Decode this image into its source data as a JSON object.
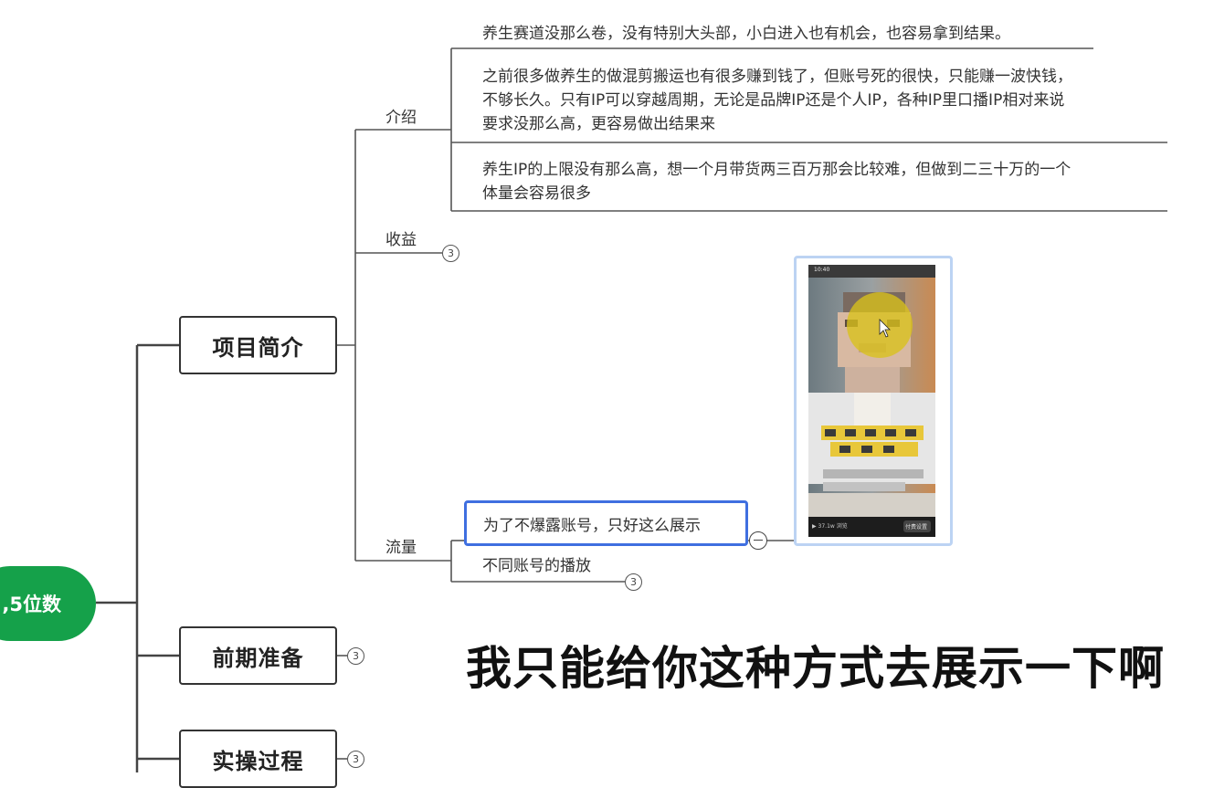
{
  "root": {
    "label": ",5位数"
  },
  "main_nodes": [
    {
      "label": "项目简介"
    },
    {
      "label": "前期准备",
      "collapsed_count": "3"
    },
    {
      "label": "实操过程",
      "collapsed_count": "3"
    }
  ],
  "project_intro": {
    "branches": {
      "intro": {
        "label": "介绍",
        "leaves": [
          "养生赛道没那么卷，没有特别大头部，小白进入也有机会，也容易拿到结果。",
          "之前很多做养生的做混剪搬运也有很多赚到钱了，但账号死的很快，只能赚一波快钱，不够长久。只有IP可以穿越周期，无论是品牌IP还是个人IP，各种IP里口播IP相对来说要求没那么高，更容易做出结果来",
          "养生IP的上限没有那么高，想一个月带货两三百万那会比较难，但做到二三十万的一个体量会容易很多"
        ],
        "leaf_lines": [
          [
            "养生赛道没那么卷，没有特别大头部，小白进入也有机会，也容易拿到结果。"
          ],
          [
            "之前很多做养生的做混剪搬运也有很多赚到钱了，但账号死的很快，只能赚一波快钱，",
            "不够长久。只有IP可以穿越周期，无论是品牌IP还是个人IP，各种IP里口播IP相对来说",
            "要求没那么高，更容易做出结果来"
          ],
          [
            "养生IP的上限没有那么高，想一个月带货两三百万那会比较难，但做到二三十万的一个",
            "体量会容易很多"
          ]
        ]
      },
      "revenue": {
        "label": "收益",
        "collapsed_count": "3"
      },
      "traffic": {
        "label": "流量",
        "leaves": [
          {
            "label": "为了不爆露账号，只好这么展示"
          },
          {
            "label": "不同账号的播放",
            "collapsed_count": "3"
          }
        ]
      }
    }
  },
  "screenshot_thumbnail": {
    "status_time": "10:40",
    "bottom_left": "▶ 37.1w 浏览",
    "bottom_right": "付费设置"
  },
  "caption": "我只能给你这种方式去展示一下啊",
  "colors": {
    "root_green": "#15a14a",
    "selection_blue": "#3f6fe0",
    "line": "#444444",
    "cursor_highlight": "#d9c21a"
  }
}
